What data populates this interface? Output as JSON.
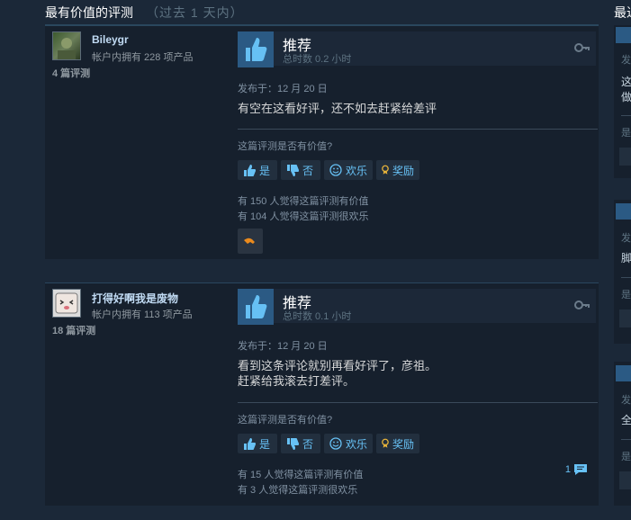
{
  "section": {
    "title": "最有价值的评测",
    "subtitle": "（过去 1 天内）"
  },
  "side_section": {
    "title": "最近"
  },
  "reviews": [
    {
      "username": "Bileygr",
      "owned": "帐户内拥有 228 项产品",
      "review_count": "4 篇评测",
      "verdict": "推荐",
      "hours": "总时数 0.2 小时",
      "posted": "发布于：12 月 20 日",
      "text": [
        "有空在这看好评，还不如去赶紧给差评"
      ],
      "helpful_q": "这篇评测是否有价值?",
      "buttons": {
        "yes": "是",
        "no": "否",
        "funny": "欢乐",
        "award": "奖励"
      },
      "helpful_stat": "有 150 人觉得这篇评测有价值",
      "funny_stat": "有 104 人觉得这篇评测很欢乐",
      "comments": ""
    },
    {
      "username": "打得好啊我是废物",
      "owned": "帐户内拥有 113 项产品",
      "review_count": "18 篇评测",
      "verdict": "推荐",
      "hours": "总时数 0.1 小时",
      "posted": "发布于：12 月 20 日",
      "text": [
        "看到这条评论就别再看好评了，彦祖。",
        "赶紧给我滚去打差评。"
      ],
      "helpful_q": "这篇评测是否有价值?",
      "buttons": {
        "yes": "是",
        "no": "否",
        "funny": "欢乐",
        "award": "奖励"
      },
      "helpful_stat": "有 15 人觉得这篇评测有价值",
      "funny_stat": "有 3 人觉得这篇评测很欢乐",
      "comments": "1"
    }
  ],
  "side_cards": [
    {
      "line1": "发",
      "line2": "这",
      "line3": "做",
      "line4": "是"
    },
    {
      "line1": "发",
      "line2": "脚",
      "line4": "是"
    },
    {
      "line1": "发",
      "line2": "全",
      "line4": "是"
    }
  ],
  "colors": {
    "accent": "#67c1f5",
    "thumb_bg": "#2b5a84",
    "bg": "#1b2838",
    "card": "#16202d"
  }
}
